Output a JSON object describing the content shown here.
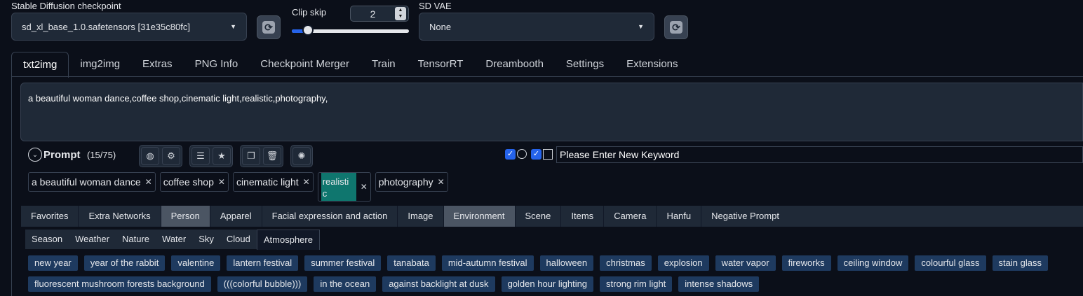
{
  "checkpoint": {
    "label": "Stable Diffusion checkpoint",
    "value": "sd_xl_base_1.0.safetensors [31e35c80fc]",
    "refresh_icon": "refresh-icon"
  },
  "clip_skip": {
    "label": "Clip skip",
    "value": "2",
    "slider_fraction": 0.14
  },
  "vae": {
    "label": "SD VAE",
    "value": "None",
    "refresh_icon": "refresh-icon"
  },
  "tabs": [
    "txt2img",
    "img2img",
    "Extras",
    "PNG Info",
    "Checkpoint Merger",
    "Train",
    "TensorRT",
    "Dreambooth",
    "Settings",
    "Extensions"
  ],
  "prompt": {
    "text": "a beautiful woman dance,coffee shop,cinematic light,realistic,photography,",
    "title": "Prompt",
    "count": "(15/75)",
    "keyword_placeholder": "Please Enter New Keyword"
  },
  "tags": [
    {
      "text": "a beautiful woman dance"
    },
    {
      "text": "coffee shop"
    },
    {
      "text": "cinematic light"
    },
    {
      "text": "realisti\nc",
      "highlight": true
    },
    {
      "text": "photography"
    }
  ],
  "categories": [
    "Favorites",
    "Extra Networks",
    "Person",
    "Apparel",
    "Facial expression and action",
    "Image",
    "Environment",
    "Scene",
    "Items",
    "Camera",
    "Hanfu",
    "Negative Prompt"
  ],
  "highlighted_categories": [
    "Person",
    "Environment"
  ],
  "subcategories": [
    "Season",
    "Weather",
    "Nature",
    "Water",
    "Sky",
    "Cloud",
    "Atmosphere"
  ],
  "active_subcategory": "Atmosphere",
  "keywords_row1": [
    "new year",
    "year of the rabbit",
    "valentine",
    "lantern festival",
    "summer festival",
    "tanabata",
    "mid-autumn festival",
    "halloween",
    "christmas",
    "explosion",
    "water vapor",
    "fireworks",
    "ceiling window",
    "colourful glass",
    "stain glass"
  ],
  "keywords_row2": [
    "fluorescent mushroom forests background",
    "(((colorful bubble)))",
    "in the ocean",
    "against backlight at dusk",
    "golden hour lighting",
    "strong rim light",
    "intense shadows"
  ],
  "colors": {
    "background": "#0b0f19",
    "tag_highlight": "#0f766e",
    "keyword_bg": "#1e3a5f",
    "accent": "#2563eb"
  }
}
